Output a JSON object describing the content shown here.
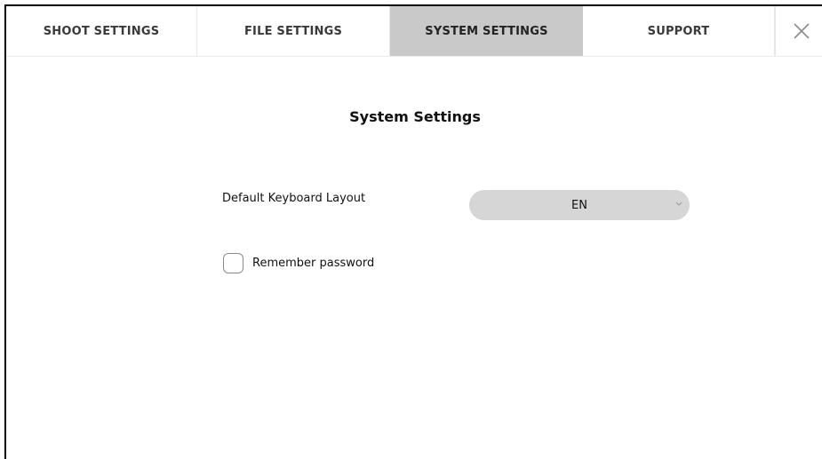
{
  "tabs": [
    {
      "label": "SHOOT SETTINGS",
      "active": false
    },
    {
      "label": "FILE SETTINGS",
      "active": false
    },
    {
      "label": "SYSTEM SETTINGS",
      "active": true
    },
    {
      "label": "SUPPORT",
      "active": false
    }
  ],
  "close_icon": "close-icon",
  "main": {
    "title": "System Settings",
    "keyboard": {
      "label": "Default Keyboard Layout",
      "selected": "EN",
      "chevron_icon": "chevron-down-icon"
    },
    "remember": {
      "label": "Remember password",
      "checked": false
    }
  },
  "colors": {
    "active_tab_bg": "#c9c9c9",
    "select_bg": "#d6d6d6",
    "border": "#000000"
  }
}
